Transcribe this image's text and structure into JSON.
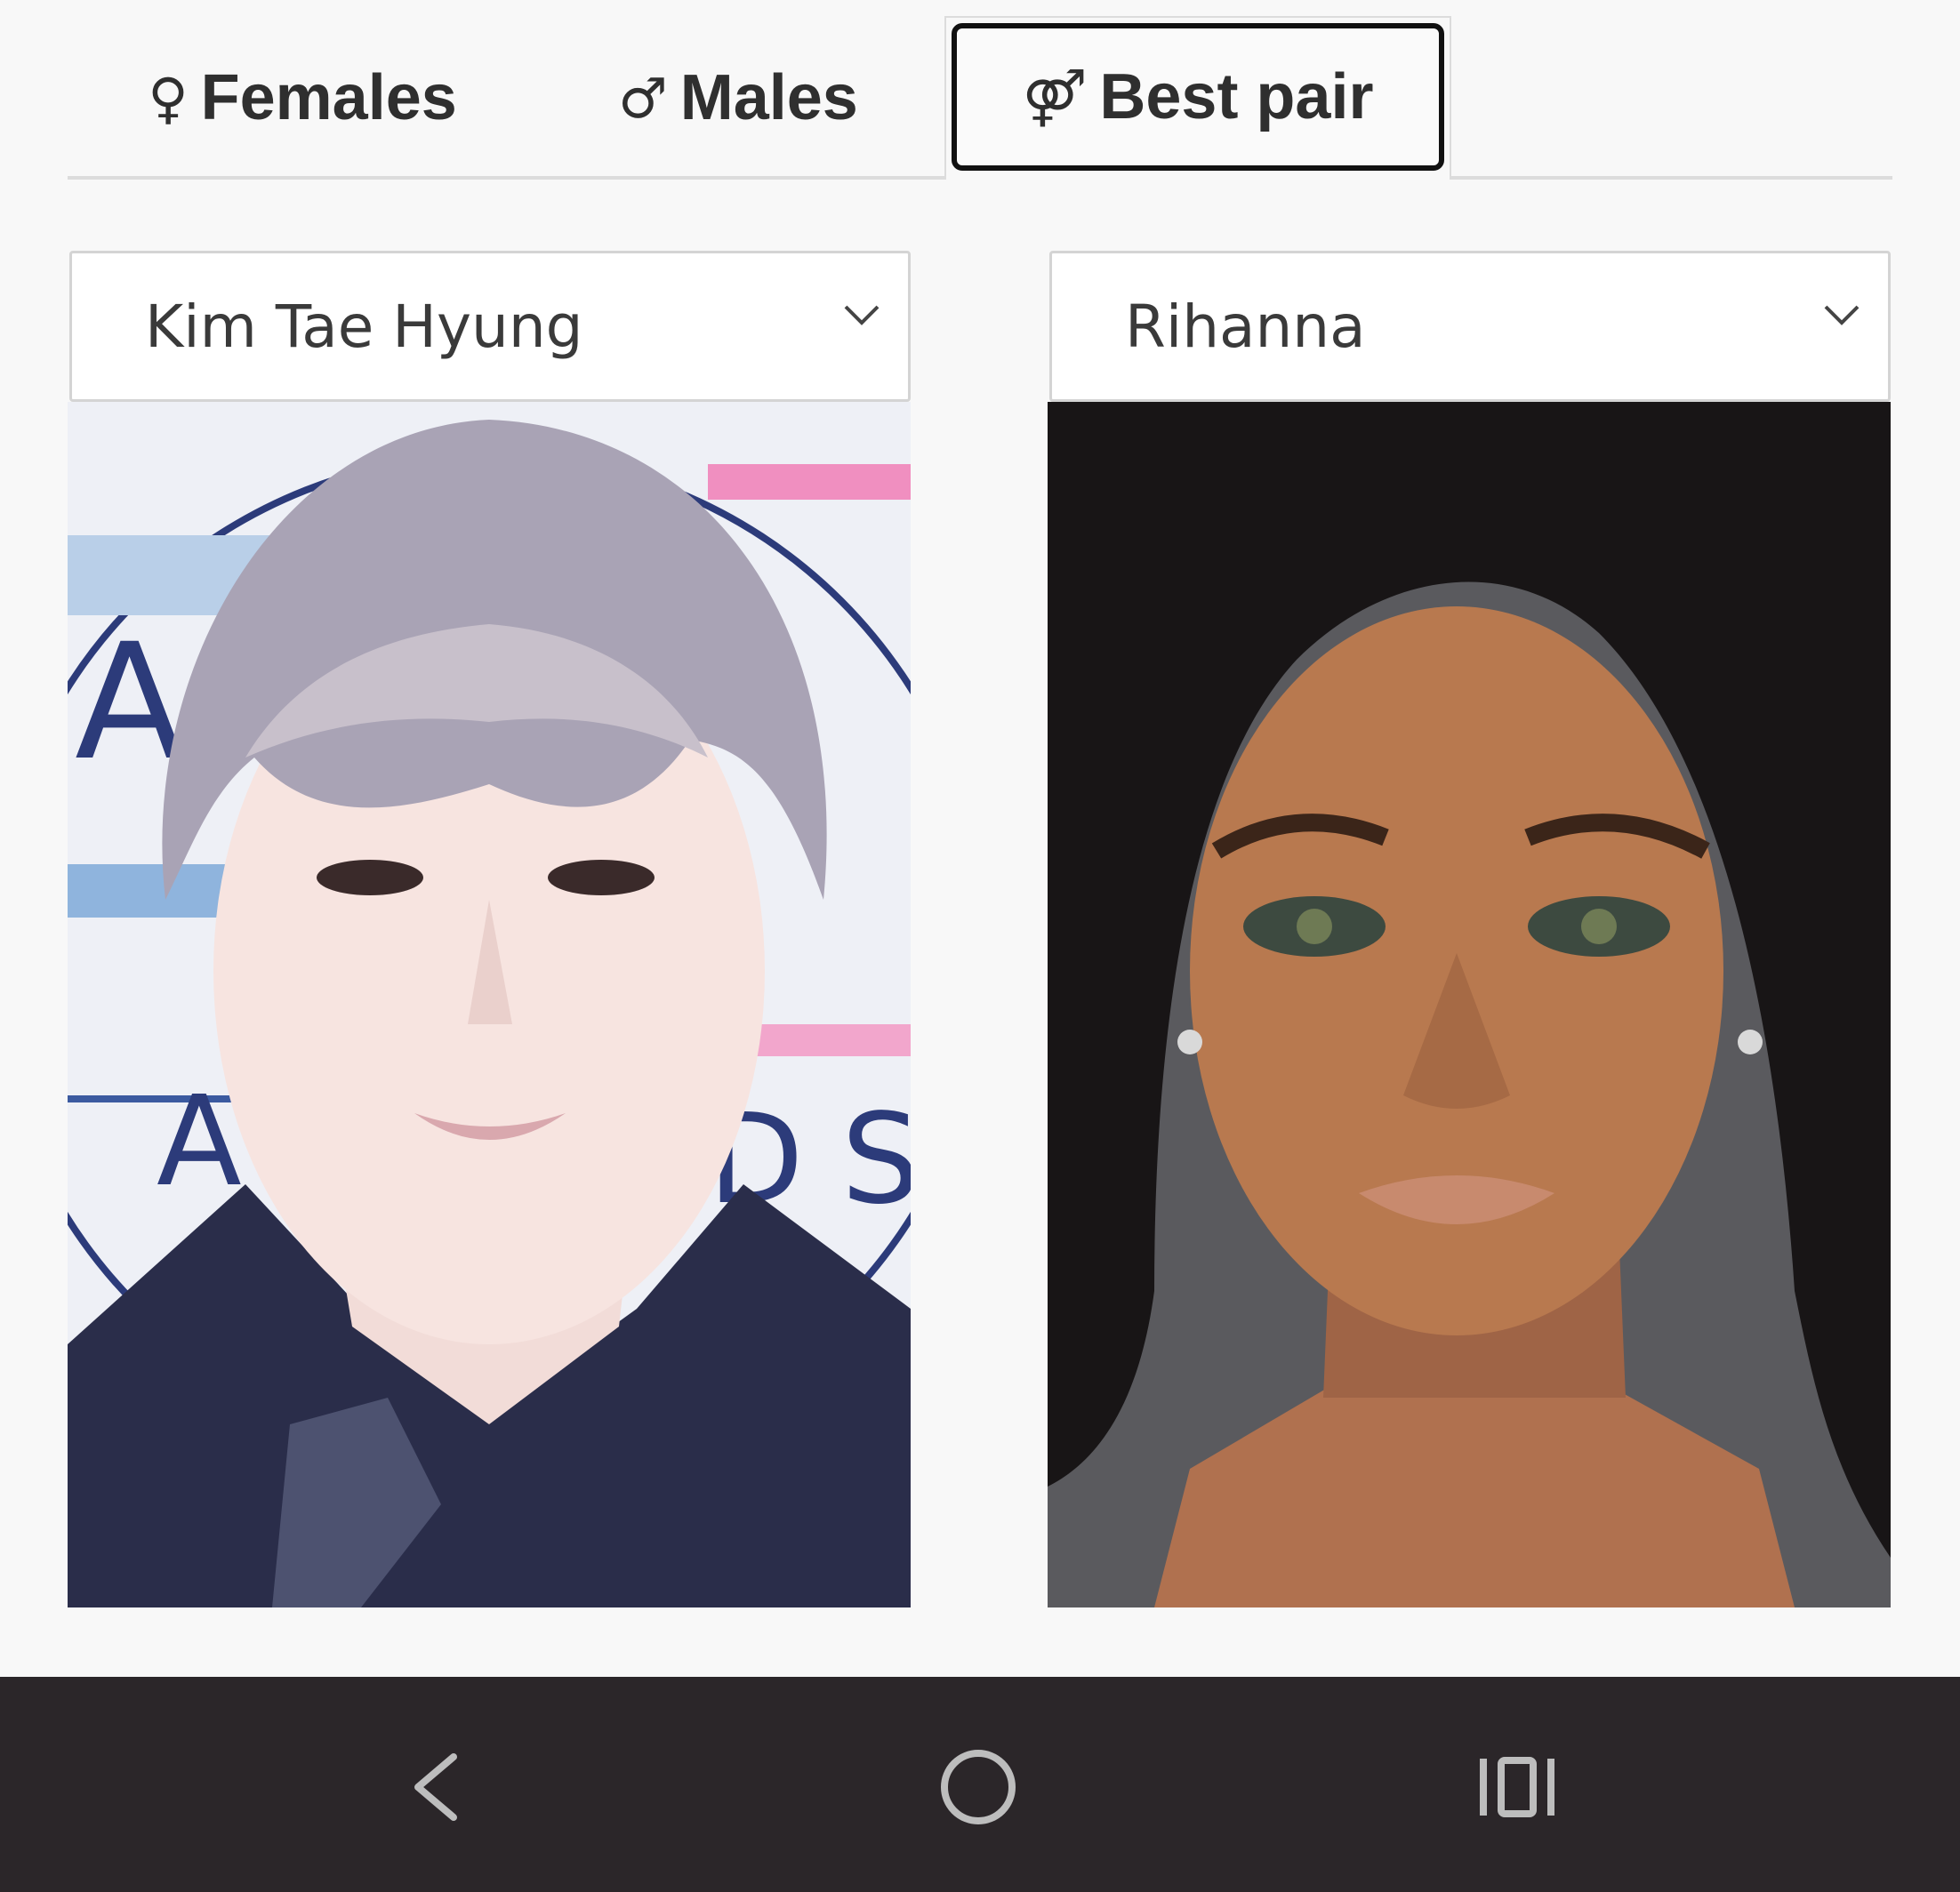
{
  "tabs": {
    "females": {
      "symbol": "♀",
      "label": "Females"
    },
    "males": {
      "symbol": "♂",
      "label": "Males"
    },
    "best_pair": {
      "symbol": "⚤",
      "label": "Best pair",
      "active": true
    }
  },
  "selects": {
    "left": {
      "value": "Kim Tae Hyung"
    },
    "right": {
      "value": "Rihanna"
    }
  },
  "photos": {
    "left_backdrop_letters": [
      "A",
      "A",
      "D",
      "S"
    ]
  },
  "nav": {
    "back_icon": "chevron-left-icon",
    "home_icon": "circle-home-icon",
    "recent_icon": "recent-apps-icon"
  },
  "colors": {
    "background": "#f8f8f8",
    "active_tab_border": "#111111",
    "navbar": "#2b2629",
    "nav_icons": "#bdbdbd"
  }
}
